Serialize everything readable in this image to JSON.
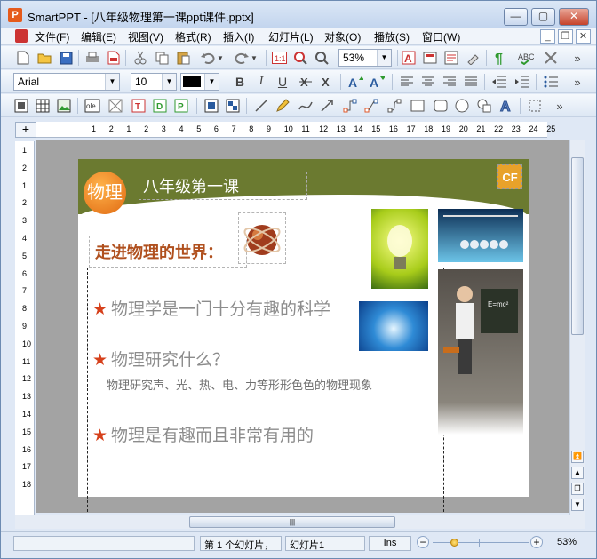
{
  "window": {
    "app_icon_letter": "P",
    "title": "SmartPPT - [八年级物理第一课ppt课件.pptx]",
    "minimize": "—",
    "maximize": "▢",
    "close": "✕"
  },
  "menu": {
    "items": [
      "文件(F)",
      "编辑(E)",
      "视图(V)",
      "格式(R)",
      "插入(I)",
      "幻灯片(L)",
      "对象(O)",
      "播放(S)",
      "窗口(W)"
    ],
    "doc_minimize": "_",
    "doc_restore": "❐",
    "doc_close": "✕"
  },
  "toolbar1": {
    "zoom_value": "53%",
    "more": "»"
  },
  "toolbar2": {
    "font_name": "Arial",
    "font_size": "10",
    "bold": "B",
    "italic": "I",
    "underline": "U",
    "more": "»"
  },
  "toolbar3": {
    "more": "»"
  },
  "ruler": {
    "corner": "+",
    "h_ticks": [
      "1",
      "2",
      "1",
      "2",
      "3",
      "4",
      "5",
      "6",
      "7",
      "8",
      "9",
      "10",
      "11",
      "12",
      "13",
      "14",
      "15",
      "16",
      "17",
      "18",
      "19",
      "20",
      "21",
      "22",
      "23",
      "24",
      "25"
    ],
    "v_ticks": [
      "1",
      "2",
      "1",
      "2",
      "3",
      "4",
      "5",
      "6",
      "7",
      "8",
      "9",
      "10",
      "11",
      "12",
      "13",
      "14",
      "15",
      "16",
      "17",
      "18"
    ]
  },
  "slide": {
    "badge": "物理",
    "title": "八年级第一课",
    "corner_logo": "CF",
    "heading": "走进物理的世界：",
    "bullets": [
      "物理学是一门十分有趣的科学",
      "物理研究什么？",
      "物理是有趣而且非常有用的"
    ],
    "bullet_star": "★",
    "sub_text": "物理研究声、光、热、电、力等形形色色的物理现象",
    "blackboard_text": "E=mc²"
  },
  "scroll": {
    "h_thumb": "|||"
  },
  "status": {
    "slide_count": "第 1 个幻灯片，",
    "slide_name": "幻灯片1",
    "mode": "Ins",
    "zoom_percent": "53%",
    "zoom_minus": "−",
    "zoom_plus": "+"
  },
  "colors": {
    "accent": "#6b7a30",
    "heading": "#b0501e",
    "star": "#d6401b"
  }
}
